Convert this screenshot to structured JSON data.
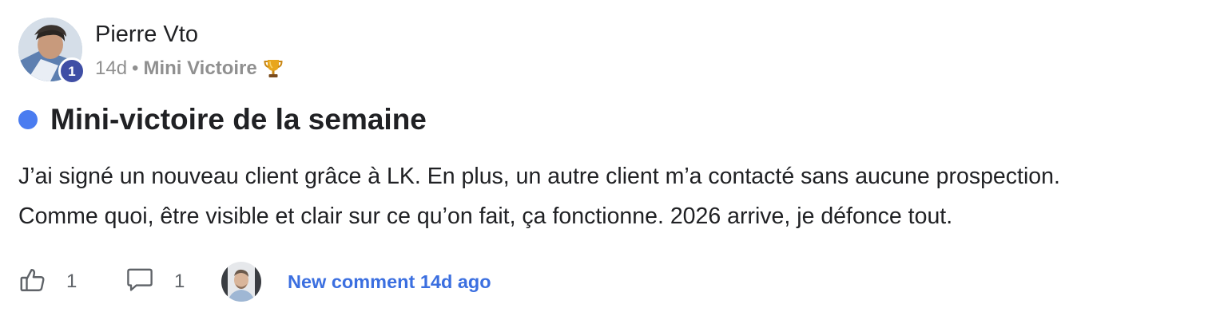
{
  "post": {
    "author": {
      "name": "Pierre Vto",
      "level": "1"
    },
    "meta": {
      "time": "14d",
      "separator": "•",
      "category": "Mini Victoire",
      "category_icon": "trophy-icon"
    },
    "unread": true,
    "title": "Mini-victoire de la semaine",
    "body": [
      "J’ai signé un nouveau client grâce à LK. En plus, un autre client m’a contacté sans aucune prospection.",
      "Comme quoi, être visible et clair sur ce qu’on fait, ça fonctionne. 2026 arrive, je défonce tout."
    ],
    "footer": {
      "like_count": "1",
      "comment_count": "1",
      "new_comment_text": "New comment 14d ago"
    }
  },
  "colors": {
    "accent": "#3b6fe0",
    "unread_dot": "#4a7cf0",
    "level_badge": "#3f4ea5",
    "meta_text": "#909090"
  }
}
